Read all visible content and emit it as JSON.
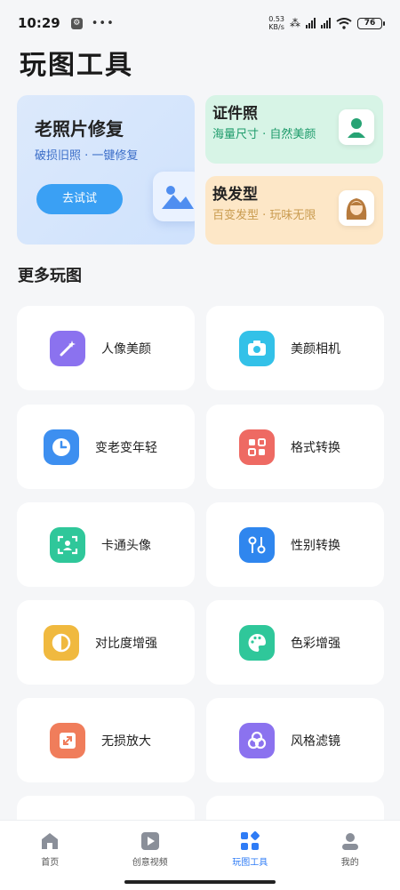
{
  "status_bar": {
    "time": "10:29",
    "net_speed_value": "0.53",
    "net_speed_unit": "KB/s",
    "battery": "76"
  },
  "page_title": "玩图工具",
  "feature_cards": {
    "old_photo": {
      "title": "老照片修复",
      "subtitle": "破损旧照 · 一键修复",
      "button": "去试试"
    },
    "id_photo": {
      "title": "证件照",
      "subtitle": "海量尺寸 · 自然美颜"
    },
    "hairstyle": {
      "title": "换发型",
      "subtitle": "百变发型 · 玩味无限"
    }
  },
  "more_section_title": "更多玩图",
  "tools": [
    {
      "label": "人像美颜",
      "icon": "magic-wand-icon",
      "color": "#8b72ef"
    },
    {
      "label": "美颜相机",
      "icon": "camera-icon",
      "color": "#33c1e8"
    },
    {
      "label": "变老变年轻",
      "icon": "clock-icon",
      "color": "#3d8ff0"
    },
    {
      "label": "格式转换",
      "icon": "format-convert-icon",
      "color": "#ee6a63"
    },
    {
      "label": "卡通头像",
      "icon": "face-scan-icon",
      "color": "#2fc79a"
    },
    {
      "label": "性别转换",
      "icon": "gender-swap-icon",
      "color": "#2f86ee"
    },
    {
      "label": "对比度增强",
      "icon": "contrast-icon",
      "color": "#f0b93f"
    },
    {
      "label": "色彩增强",
      "icon": "palette-icon",
      "color": "#2fc79a"
    },
    {
      "label": "无损放大",
      "icon": "expand-icon",
      "color": "#f07d5b"
    },
    {
      "label": "风格滤镜",
      "icon": "filter-circles-icon",
      "color": "#8b72ef"
    }
  ],
  "bottom_nav": [
    {
      "label": "首页",
      "icon": "home-icon"
    },
    {
      "label": "创意视频",
      "icon": "video-icon"
    },
    {
      "label": "玩图工具",
      "icon": "tools-grid-icon",
      "active": true
    },
    {
      "label": "我的",
      "icon": "profile-icon"
    }
  ],
  "colors": {
    "accent": "#2f7cf6",
    "try_button": "#3aa0f4"
  }
}
